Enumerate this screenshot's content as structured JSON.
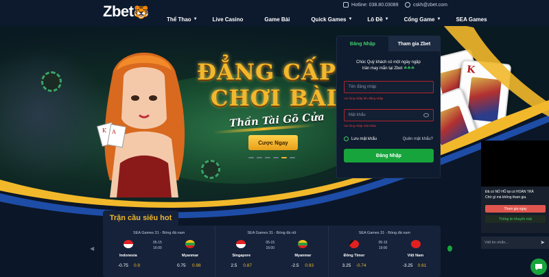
{
  "brand": {
    "logo_text": "Zbet",
    "logo_icon": "tiger-icon"
  },
  "contact": {
    "hotline": "Hotline: 038.80.03089",
    "email": "cskh@zbet.com",
    "hotline_icon": "phone-icon",
    "email_icon": "headset-icon"
  },
  "nav": {
    "items": [
      {
        "label": "Thể Thao",
        "has_dropdown": true
      },
      {
        "label": "Live Casino",
        "has_dropdown": false
      },
      {
        "label": "Game Bài",
        "has_dropdown": false
      },
      {
        "label": "Quick Games",
        "has_dropdown": true
      },
      {
        "label": "Lô Đề",
        "has_dropdown": true
      },
      {
        "label": "Cổng Game",
        "has_dropdown": true
      },
      {
        "label": "SEA Games",
        "has_dropdown": false
      }
    ]
  },
  "hero": {
    "headline_1": "ĐẲNG CẤP",
    "headline_2": "CHƠI BÀI",
    "tagline": "Thần Tài Gõ Cửa",
    "cta": "Cược Ngay",
    "slides_total": 6,
    "slide_active": 5,
    "card_rank_1": "A",
    "card_rank_2": "K",
    "card_rank_3": "A"
  },
  "login": {
    "tab_login": "Đăng Nhập",
    "tab_register": "Tham gia Zbet",
    "welcome_line_1": "Chúc Quý khách có một ngày ngập",
    "welcome_line_2": "tràn may mắn tại Zbet",
    "welcome_leaves": "☘☘☘",
    "username_placeholder": "Tên đăng nhập",
    "username_error": "Vui lòng nhập tên đăng nhập",
    "password_placeholder": "Mật khẩu",
    "password_error": "Vui lòng nhập mật khẩu",
    "remember": "Lưu mật khẩu",
    "forgot": "Quên mật khẩu?",
    "submit": "Đăng Nhập"
  },
  "matches": {
    "section_title": "Trận cầu siêu hot",
    "list": [
      {
        "title": "SEA Games 31 - Bóng đá nam",
        "date": "05-15",
        "time": "16:00",
        "home": "Indonesia",
        "away": "Myanmar",
        "home_hcp": "-0.75",
        "home_odd": "0.9",
        "away_hcp": "0.75",
        "away_odd": "0.98"
      },
      {
        "title": "SEA Games 31 - Bóng đá nữ",
        "date": "05-15",
        "time": "16:00",
        "home": "Singapore",
        "away": "Myanmar",
        "home_hcp": "2.5",
        "home_odd": "0.87",
        "away_hcp": "-2.5",
        "away_odd": "0.93"
      },
      {
        "title": "SEA Games 31 - Bóng đá nam",
        "date": "05-15",
        "time": "19:00",
        "home": "Đông Timor",
        "away": "Việt Nam",
        "home_hcp": "3.25",
        "home_odd": "-0.74",
        "away_hcp": "-3.25",
        "away_odd": "0.61"
      }
    ]
  },
  "chat": {
    "message_line_1": "Đã có NỔ HŨ lại có HOÀN TRẢ",
    "message_line_2": "Chờ gì mà không tham gia.",
    "join_button": "Tham gia ngay",
    "promo_link": "Thông tin khuyến mãi",
    "input_placeholder": "Viết tin nhắn...",
    "send_icon": "send-icon",
    "bubble_icon": "chat-bubble-icon"
  },
  "colors": {
    "accent_gold": "#f2b82b",
    "accent_green": "#17a43c",
    "error_red": "#e33d3d",
    "bg": "#0b1628"
  }
}
